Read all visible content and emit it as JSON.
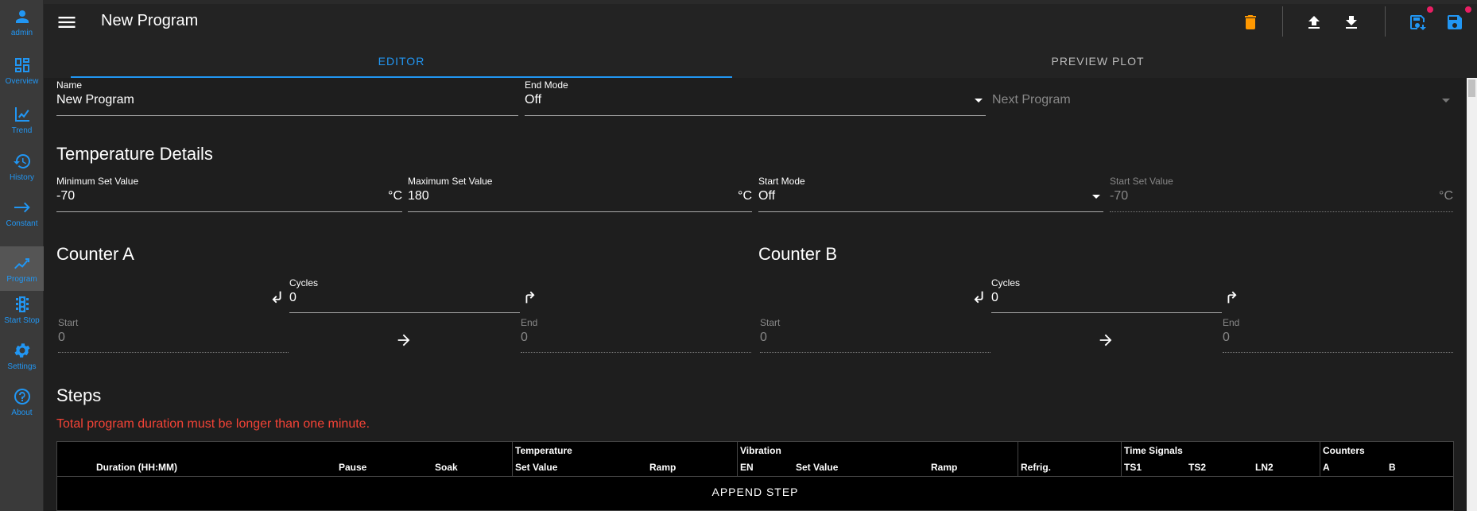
{
  "sidebar": {
    "items": [
      {
        "label": "admin",
        "icon": "person-icon"
      },
      {
        "label": "Overview",
        "icon": "dashboard-icon"
      },
      {
        "label": "Trend",
        "icon": "trend-icon"
      },
      {
        "label": "History",
        "icon": "history-icon"
      },
      {
        "label": "Constant",
        "icon": "arrow-right-icon"
      },
      {
        "label": "Program",
        "icon": "program-icon"
      },
      {
        "label": "Start Stop",
        "icon": "traffic-light-icon"
      },
      {
        "label": "Settings",
        "icon": "gear-icon"
      },
      {
        "label": "About",
        "icon": "help-icon"
      }
    ]
  },
  "header": {
    "title": "New Program"
  },
  "tabs": {
    "editor": "EDITOR",
    "preview": "PREVIEW PLOT"
  },
  "general": {
    "name_label": "Name",
    "name_value": "New Program",
    "end_mode_label": "End Mode",
    "end_mode_value": "Off",
    "next_program_placeholder": "Next Program"
  },
  "temperature": {
    "title": "Temperature Details",
    "min_label": "Minimum Set Value",
    "min_value": "-70",
    "max_label": "Maximum Set Value",
    "max_value": "180",
    "start_mode_label": "Start Mode",
    "start_mode_value": "Off",
    "start_set_label": "Start Set Value",
    "start_set_value": "-70",
    "unit": "°C"
  },
  "counter_a": {
    "title": "Counter A",
    "cycles_label": "Cycles",
    "cycles_value": "0",
    "start_label": "Start",
    "start_value": "0",
    "end_label": "End",
    "end_value": "0"
  },
  "counter_b": {
    "title": "Counter B",
    "cycles_label": "Cycles",
    "cycles_value": "0",
    "start_label": "Start",
    "start_value": "0",
    "end_label": "End",
    "end_value": "0"
  },
  "steps": {
    "title": "Steps",
    "warning": "Total program duration must be longer than one minute.",
    "headers": {
      "duration": "Duration (HH:MM)",
      "pause": "Pause",
      "soak": "Soak",
      "temperature": "Temperature",
      "temp_set": "Set Value",
      "temp_ramp": "Ramp",
      "vibration": "Vibration",
      "vib_en": "EN",
      "vib_set": "Set Value",
      "vib_ramp": "Ramp",
      "refrig": "Refrig.",
      "time_signals": "Time Signals",
      "ts1": "TS1",
      "ts2": "TS2",
      "ln2": "LN2",
      "counters": "Counters",
      "counter_a": "A",
      "counter_b": "B"
    },
    "append_label": "APPEND STEP"
  },
  "colors": {
    "accent": "#2196f3",
    "delete": "#ff9800",
    "warning": "#f44336",
    "badge": "#e91e63"
  }
}
